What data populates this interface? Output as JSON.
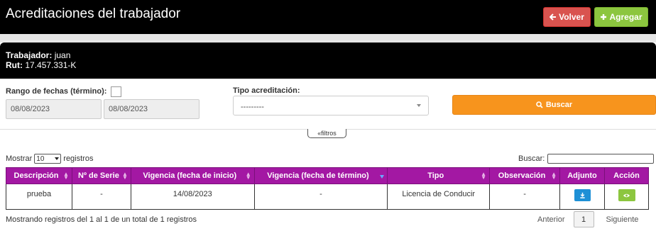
{
  "header": {
    "title": "Acreditaciones del trabajador",
    "back_label": "Volver",
    "add_label": "Agregar"
  },
  "worker": {
    "name_label": "Trabajador:",
    "name_value": "juan",
    "rut_label": "Rut:",
    "rut_value": "17.457.331-K"
  },
  "filters": {
    "date_range_label": "Rango de fechas (término):",
    "date_from": "08/08/2023",
    "date_to": "08/08/2023",
    "type_label": "Tipo acreditación:",
    "type_selected": "---------",
    "search_button": "Buscar",
    "toggle_label": "filtros"
  },
  "table_controls": {
    "show_prefix": "Mostrar",
    "page_size": "10",
    "show_suffix": "registros",
    "search_label": "Buscar:"
  },
  "table": {
    "columns": [
      "Descripción",
      "Nº de Serie",
      "Vigencia (fecha de inicio)",
      "Vigencia (fecha de término)",
      "Tipo",
      "Observación",
      "Adjunto",
      "Acción"
    ],
    "rows": [
      {
        "descripcion": "prueba",
        "serie": "-",
        "inicio": "14/08/2023",
        "termino": "-",
        "tipo": "Licencia de Conducir",
        "observacion": "-"
      }
    ]
  },
  "footer": {
    "info": "Mostrando registros del 1 al 1 de un total de 1 registros",
    "prev": "Anterior",
    "page": "1",
    "next": "Siguiente"
  },
  "colors": {
    "header_bg": "#000000",
    "table_header": "#a318a3",
    "back_button": "#d9534f",
    "add_button": "#8cc63f",
    "search_button": "#f7941d",
    "download_button": "#1e90d6"
  },
  "icons": {
    "back": "arrow-left-icon",
    "add": "plus-icon",
    "search": "search-icon",
    "download": "download-icon",
    "view": "eye-icon",
    "sort": "sort-icon"
  }
}
